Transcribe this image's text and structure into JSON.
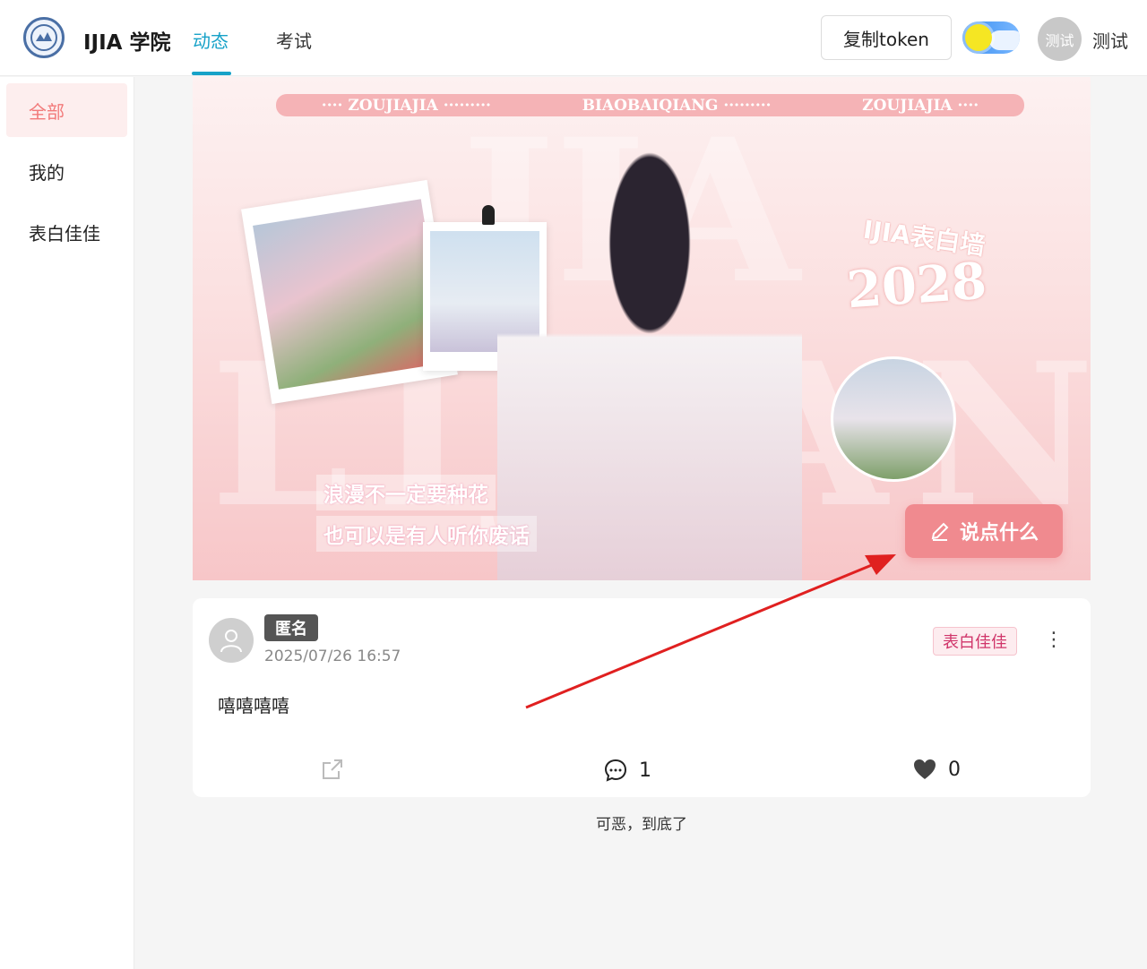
{
  "header": {
    "brand": "IJIA 学院",
    "tabs": [
      {
        "label": "动态",
        "active": true
      },
      {
        "label": "考试",
        "active": false
      }
    ],
    "copy_token_label": "复制token",
    "avatar_text": "测试",
    "user_name": "测试"
  },
  "sidebar": {
    "items": [
      {
        "label": "全部",
        "active": true
      },
      {
        "label": "我的",
        "active": false
      },
      {
        "label": "表白佳佳",
        "active": false
      }
    ]
  },
  "banner": {
    "strip_text": [
      "···· ZOUJIAJIA ·········",
      "BIAOBAIQIANG ·········",
      "ZOUJIAJIA ····"
    ],
    "wall_title": "IJIA表白墙",
    "year": "2028",
    "quote_line1": "浪漫不一定要种花",
    "quote_line2": "也可以是有人听你废话",
    "say_button_label": "说点什么"
  },
  "post": {
    "badge": "匿名",
    "time": "2025/07/26 16:57",
    "tag": "表白佳佳",
    "content": "嘻嘻嘻嘻",
    "comment_count": "1",
    "like_count": "0"
  },
  "footer_text": "可恶，到底了",
  "colors": {
    "accent": "#17a2c8",
    "sidebar_active_bg": "#fdeeee",
    "sidebar_active_text": "#f27a7a",
    "say_button": "#f08a8f",
    "tag_text": "#d0356a",
    "arrow": "#e02020"
  }
}
